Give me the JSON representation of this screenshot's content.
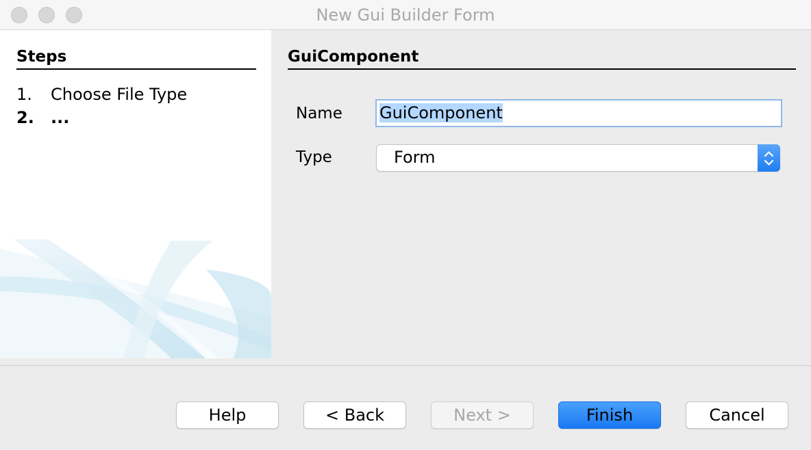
{
  "window": {
    "title": "New Gui Builder Form"
  },
  "steps": {
    "heading": "Steps",
    "items": [
      {
        "number": "1.",
        "label": "Choose File Type"
      },
      {
        "number": "2.",
        "label": "..."
      }
    ]
  },
  "form": {
    "heading": "GuiComponent",
    "name_label": "Name",
    "name_value": "GuiComponent",
    "type_label": "Type",
    "type_value": "Form"
  },
  "buttons": {
    "help": "Help",
    "back": "< Back",
    "next": "Next >",
    "finish": "Finish",
    "cancel": "Cancel"
  },
  "colors": {
    "accent": "#1f7ef2",
    "selection": "#b3d7ff",
    "disabled_text": "#a6a6a6"
  }
}
